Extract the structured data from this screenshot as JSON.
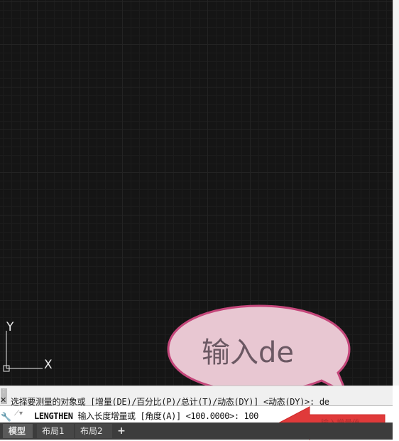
{
  "drawing_area": {
    "ucs_y_label": "Y",
    "ucs_x_label": "X"
  },
  "callout": {
    "text": "输入de"
  },
  "command_history": {
    "text": "选择要测量的对象或 [增量(DE)/百分比(P)/总计(T)/动态(DY)] <动态(DY)>: de"
  },
  "command_line": {
    "command": "LENGTHEN",
    "prompt": "输入长度增量或 [角度(A)] <100.0000>:",
    "value": "100"
  },
  "annotation": {
    "arrow_label": "输入增量值"
  },
  "layout_tabs": {
    "tabs": [
      "模型",
      "布局1",
      "布局2"
    ],
    "add_label": "+"
  },
  "colors": {
    "canvas_bg": "#151515",
    "callout_fill": "#e8c7d2",
    "callout_border": "#c4467a",
    "arrow_red": "#e03a3a"
  }
}
